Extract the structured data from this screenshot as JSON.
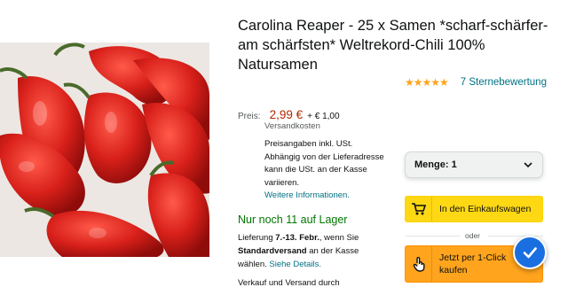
{
  "product": {
    "title": "Carolina Reaper - 25 x Samen *scharf-schärfer- am schärfsten* Weltrekord-Chili 100% Natursamen",
    "rating_stars": "★★★★★",
    "rating_text": "7 Sternebewertung",
    "image_alt": "Carolina Reaper chili peppers"
  },
  "price": {
    "label": "Preis:",
    "amount": "2,99 €",
    "shipping": "+ € 1,00",
    "shipping_sub": "Versandkosten",
    "info_text": "Preisangaben inkl. USt. Abhängig von der Lieferadresse kann die USt. an der Kasse variieren.",
    "info_link": "Weitere Informationen."
  },
  "availability": {
    "stock": "Nur noch 11 auf Lager",
    "delivery_prefix": "Lieferung",
    "delivery_date": "7.-13. Febr.",
    "delivery_mid": ", wenn Sie",
    "delivery_method": "Standardversand",
    "delivery_suffix": "an der Kasse wählen.",
    "details_link": "Siehe Details.",
    "seller": "Verkauf und Versand durch"
  },
  "buybox": {
    "quantity_label": "Menge:",
    "quantity_value": "1",
    "cart_button": "In den Einkaufswagen",
    "or_text": "oder",
    "buynow_button": "Jetzt per 1-Click kaufen"
  },
  "colors": {
    "price": "#b12704",
    "link": "#007185",
    "stock": "#007600",
    "cart_button": "#ffd814",
    "buynow_button": "#ffa41c",
    "fab": "#1a6fe0"
  },
  "icons": {
    "cart": "cart-icon",
    "tap": "tap-hand-icon",
    "chevron": "chevron-down-icon",
    "check": "check-icon"
  }
}
